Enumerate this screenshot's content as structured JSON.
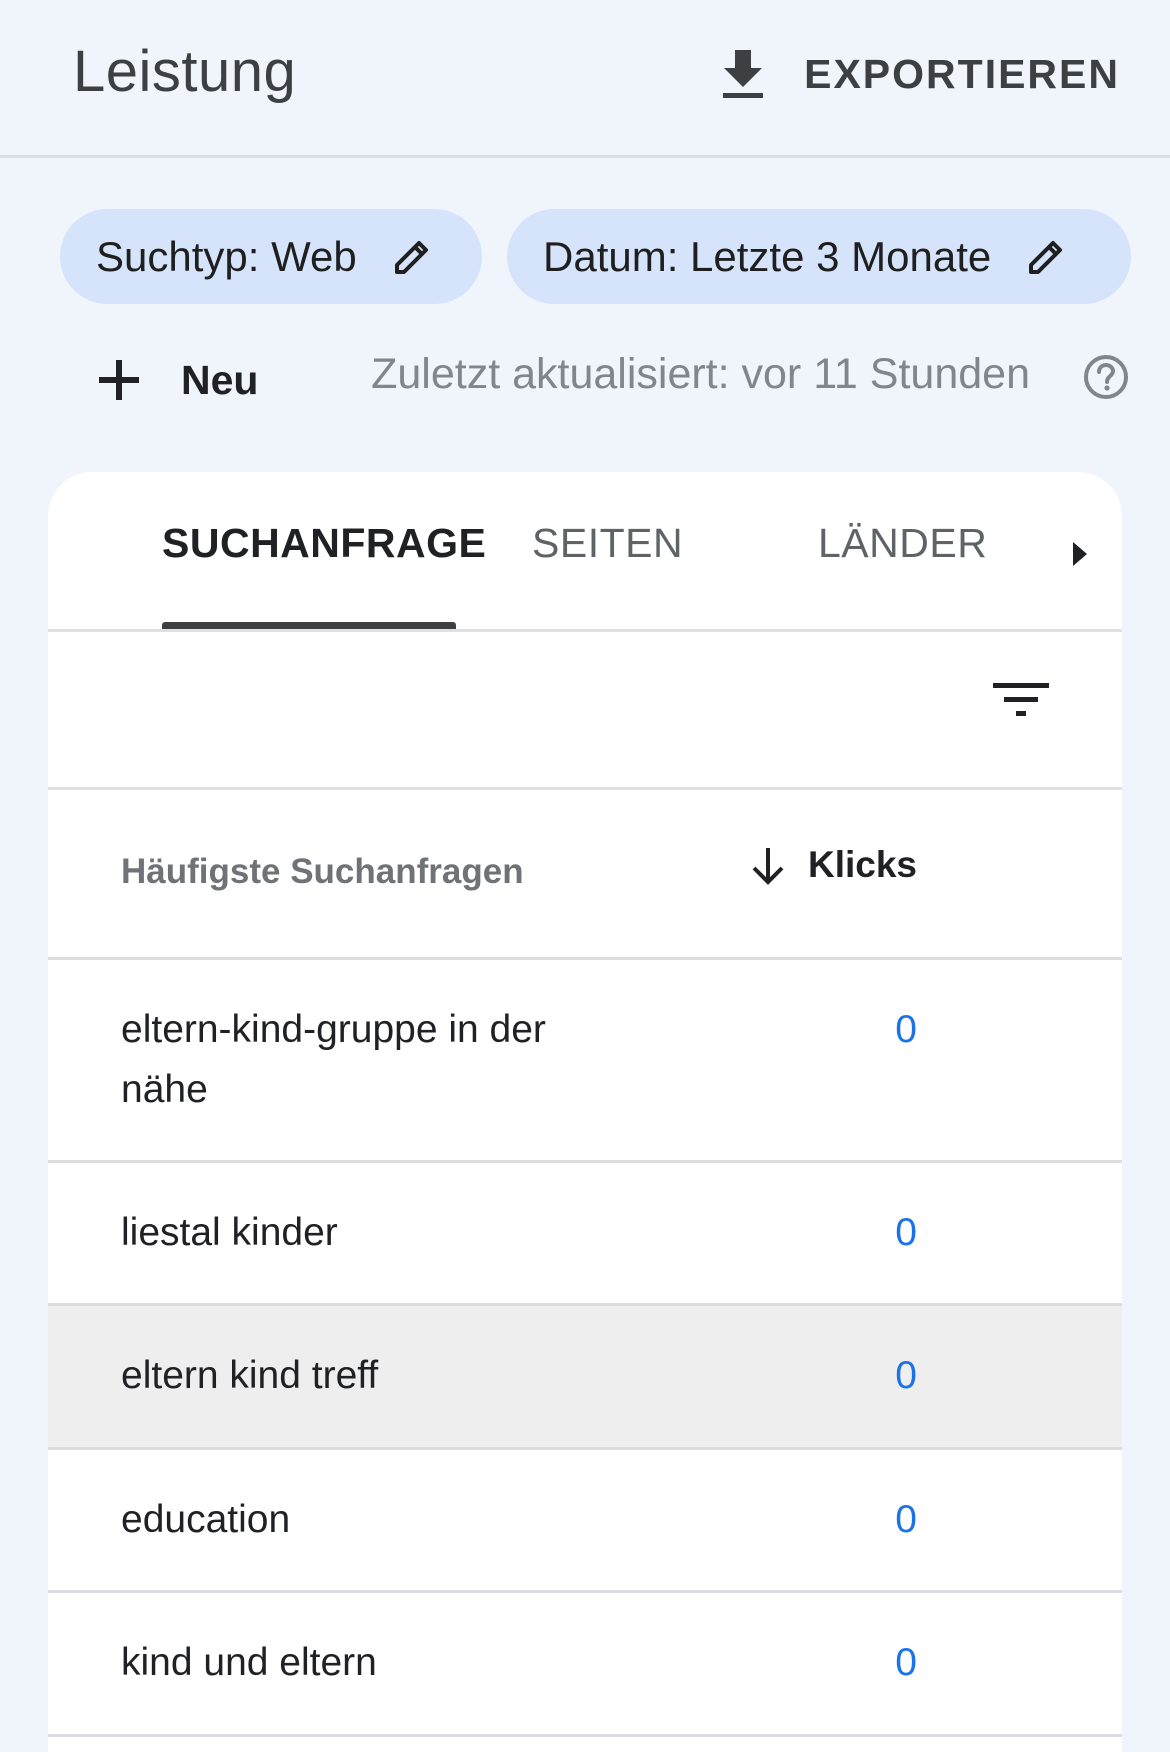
{
  "header": {
    "title": "Leistung",
    "export_label": "EXPORTIEREN"
  },
  "filters": {
    "search_type": "Suchtyp: Web",
    "date": "Datum: Letzte 3 Monate"
  },
  "toolbar": {
    "new_label": "Neu",
    "last_updated": "Zuletzt aktualisiert: vor 11 Stunden"
  },
  "tabs": [
    {
      "label": "SUCHANFRAGE",
      "active": true
    },
    {
      "label": "SEITEN",
      "active": false
    },
    {
      "label": "LÄNDER",
      "active": false
    }
  ],
  "table": {
    "query_header": "Häufigste Suchanfragen",
    "clicks_header": "Klicks",
    "rows": [
      {
        "query": "eltern-kind-gruppe in der nähe",
        "clicks": "0"
      },
      {
        "query": "liestal kinder",
        "clicks": "0"
      },
      {
        "query": "eltern kind treff",
        "clicks": "0"
      },
      {
        "query": "education",
        "clicks": "0"
      },
      {
        "query": "kind und eltern",
        "clicks": "0"
      }
    ]
  },
  "icons": {
    "export": "download-icon",
    "edit": "pencil-icon",
    "new": "plus-icon",
    "help": "help-circle-icon",
    "tabs_more": "chevron-right-icon",
    "filter": "filter-icon",
    "sort": "arrow-down-icon"
  },
  "colors": {
    "background": "#f0f4fb",
    "chip": "#d5e3fb",
    "link": "#1a73e8"
  }
}
